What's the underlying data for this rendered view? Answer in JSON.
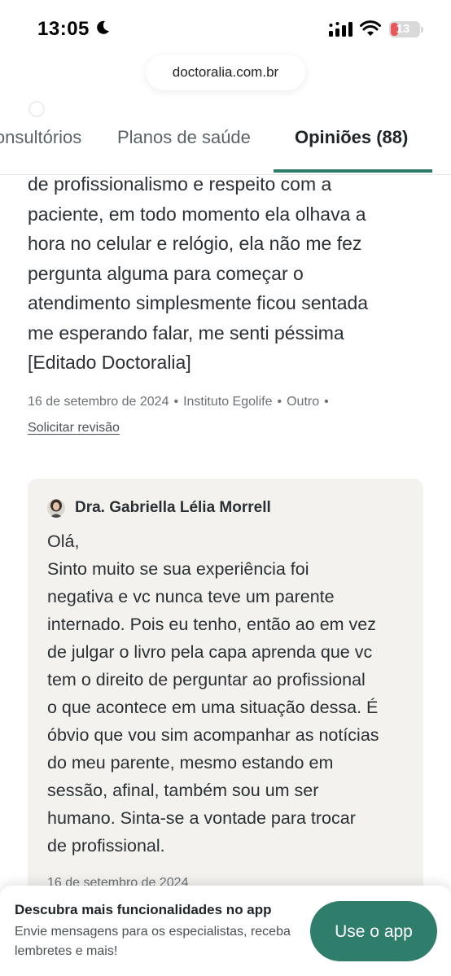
{
  "status_bar": {
    "time": "13:05",
    "battery": "13"
  },
  "browser": {
    "url": "doctoralia.com.br"
  },
  "tabs": [
    {
      "label": "Consultórios"
    },
    {
      "label": "Planos de saúde"
    },
    {
      "label": "Opiniões (88)"
    }
  ],
  "review": {
    "lines": [
      "de profissionalismo e respeito com a",
      "paciente, em todo momento ela olhava a",
      "hora no celular e relógio, ela não me fez",
      "pergunta alguma para começar o",
      "atendimento simplesmente ficou sentada",
      "me esperando falar, me senti péssima",
      "[Editado Doctoralia]"
    ],
    "date": "16 de setembro de 2024",
    "clinic": "Instituto Egolife",
    "category": "Outro",
    "request_review": "Solicitar revisão"
  },
  "reply": {
    "doctor_name": "Dra. Gabriella Lélia Morrell",
    "lines": [
      "Olá,",
      "Sinto muito se sua experiência foi",
      "negativa e vc nunca teve um parente",
      "internado. Pois eu tenho, então ao em vez",
      "de julgar o livro pela capa aprenda que vc",
      "tem o direito de perguntar ao profissional",
      "o que acontece em uma situação dessa. É",
      "óbvio que vou sim acompanhar as notícias",
      "do meu parente, mesmo estando em",
      "sessão, afinal, também sou um ser",
      "humano. Sinta-se a vontade para trocar",
      "de profissional."
    ],
    "date": "16 de setembro de 2024"
  },
  "banner": {
    "title": "Descubra mais funcionalidades no app",
    "subtitle": "Envie mensagens para os especialistas, receba lembretes e mais!",
    "button": "Use o app"
  },
  "colors": {
    "accent": "#2c7a69",
    "button": "#2f7d6b",
    "reply_bg": "#f3f2ef",
    "battery_low": "#e8575a"
  },
  "icons": [
    "moon-icon",
    "signal-icon",
    "wifi-icon",
    "battery-icon",
    "avatar"
  ]
}
